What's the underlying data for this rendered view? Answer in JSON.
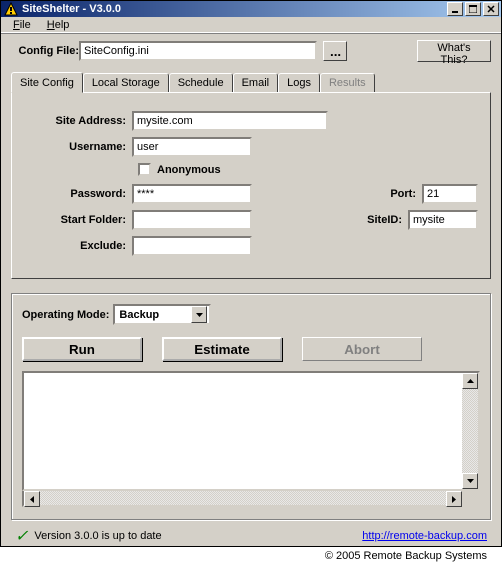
{
  "window": {
    "title": "SiteShelter - V3.0.0"
  },
  "menu": {
    "file": "File",
    "help": "Help"
  },
  "top": {
    "config_file_label": "Config File:",
    "config_file_value": "SiteConfig.ini",
    "browse_label": "...",
    "whats_this": "What's This?"
  },
  "tabs": {
    "site_config": "Site Config",
    "local_storage": "Local Storage",
    "schedule": "Schedule",
    "email": "Email",
    "logs": "Logs",
    "results": "Results"
  },
  "form": {
    "site_address_label": "Site Address:",
    "site_address_value": "mysite.com",
    "username_label": "Username:",
    "username_value": "user",
    "anonymous_label": "Anonymous",
    "password_label": "Password:",
    "password_value": "****",
    "port_label": "Port:",
    "port_value": "21",
    "start_folder_label": "Start Folder:",
    "start_folder_value": "",
    "siteid_label": "SiteID:",
    "siteid_value": "mysite",
    "exclude_label": "Exclude:",
    "exclude_value": ""
  },
  "mode": {
    "label": "Operating Mode:",
    "value": "Backup"
  },
  "actions": {
    "run": "Run",
    "estimate": "Estimate",
    "abort": "Abort"
  },
  "footer": {
    "version_status": "Version 3.0.0 is up to date",
    "link_text": "http://remote-backup.com",
    "copyright": "© 2005 Remote Backup Systems"
  }
}
